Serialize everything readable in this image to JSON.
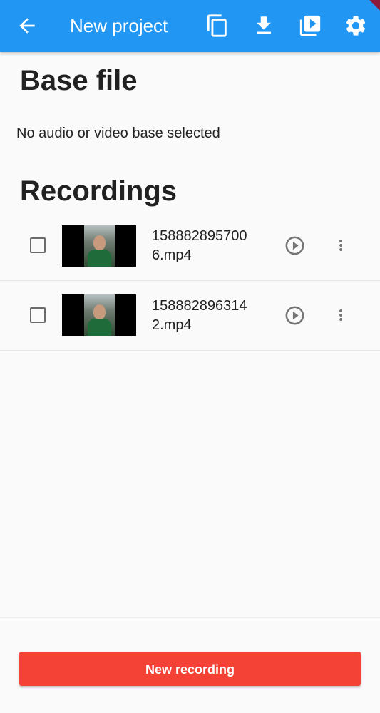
{
  "appbar": {
    "title": "New project",
    "back_icon": "arrow-back-icon",
    "actions": [
      "copy-icon",
      "download-icon",
      "video-library-icon",
      "settings-icon"
    ],
    "color": "#2196f3"
  },
  "base_file": {
    "heading": "Base file",
    "message": "No audio or video base selected"
  },
  "recordings": {
    "heading": "Recordings",
    "items": [
      {
        "filename": "1588828957006.mp4",
        "checked": false
      },
      {
        "filename": "1588828963142.mp4",
        "checked": false
      }
    ]
  },
  "new_recording": {
    "label": "New recording",
    "color": "#f44336"
  }
}
